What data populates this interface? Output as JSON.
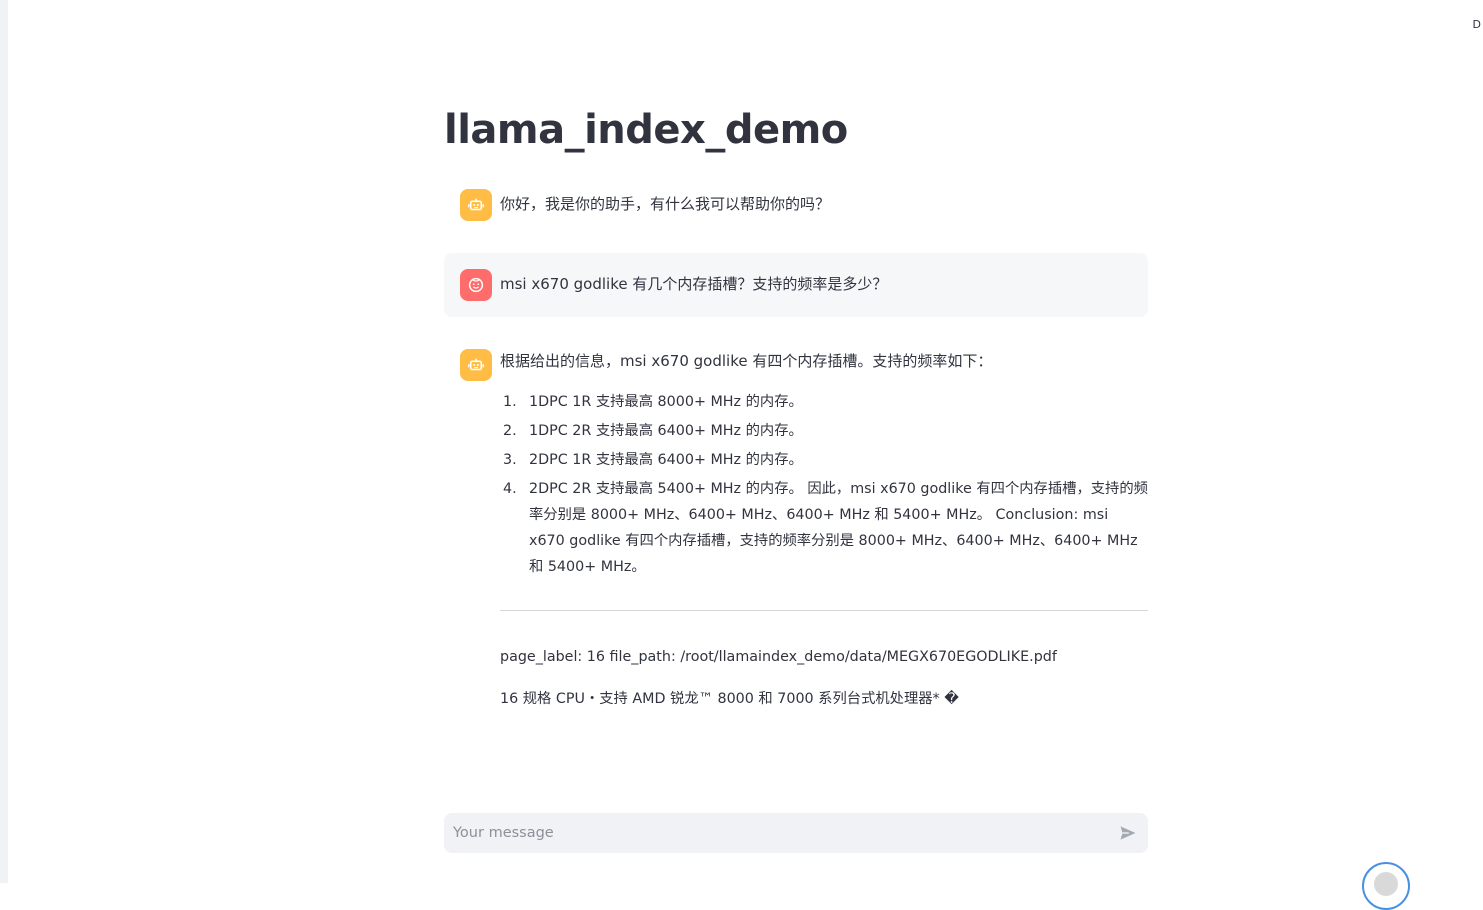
{
  "app": {
    "title": "llama_index_demo",
    "corner_mark": "D"
  },
  "messages": [
    {
      "role": "assistant",
      "avatar_icon": "robot-icon",
      "text": "你好，我是你的助手，有什么我可以帮助你的吗？"
    },
    {
      "role": "user",
      "avatar_icon": "face-icon",
      "text": "msi x670 godlike 有几个内存插槽？支持的频率是多少？"
    },
    {
      "role": "assistant",
      "avatar_icon": "robot-icon",
      "intro": "根据给出的信息，msi x670 godlike 有四个内存插槽。支持的频率如下：",
      "items": [
        {
          "num": "1.",
          "text": "1DPC 1R 支持最高 8000+ MHz 的内存。"
        },
        {
          "num": "2.",
          "text": "1DPC 2R 支持最高 6400+ MHz 的内存。"
        },
        {
          "num": "3.",
          "text": "2DPC 1R 支持最高 6400+ MHz 的内存。"
        },
        {
          "num": "4.",
          "text": "2DPC 2R 支持最高 5400+ MHz 的内存。 因此，msi x670 godlike 有四个内存插槽，支持的频率分别是 8000+ MHz、6400+ MHz、6400+ MHz 和 5400+ MHz。 Conclusion: msi x670 godlike 有四个内存插槽，支持的频率分别是 8000+ MHz、6400+ MHz、6400+ MHz 和 5400+ MHz。"
        }
      ],
      "source_meta": "page_label: 16 file_path: /root/llamaindex_demo/data/MEGX670EGODLIKE.pdf",
      "source_excerpt": "16 规格 CPU・支持 AMD 锐龙™ 8000 和 7000 系列台式机处理器* �"
    }
  ],
  "chat_input": {
    "placeholder": "Your message",
    "value": ""
  },
  "colors": {
    "assistant_avatar": "#ffbd45",
    "user_avatar": "#ff6c6c",
    "user_bubble": "#f6f7f9",
    "input_bg": "#f0f2f6",
    "text": "#31333f"
  }
}
